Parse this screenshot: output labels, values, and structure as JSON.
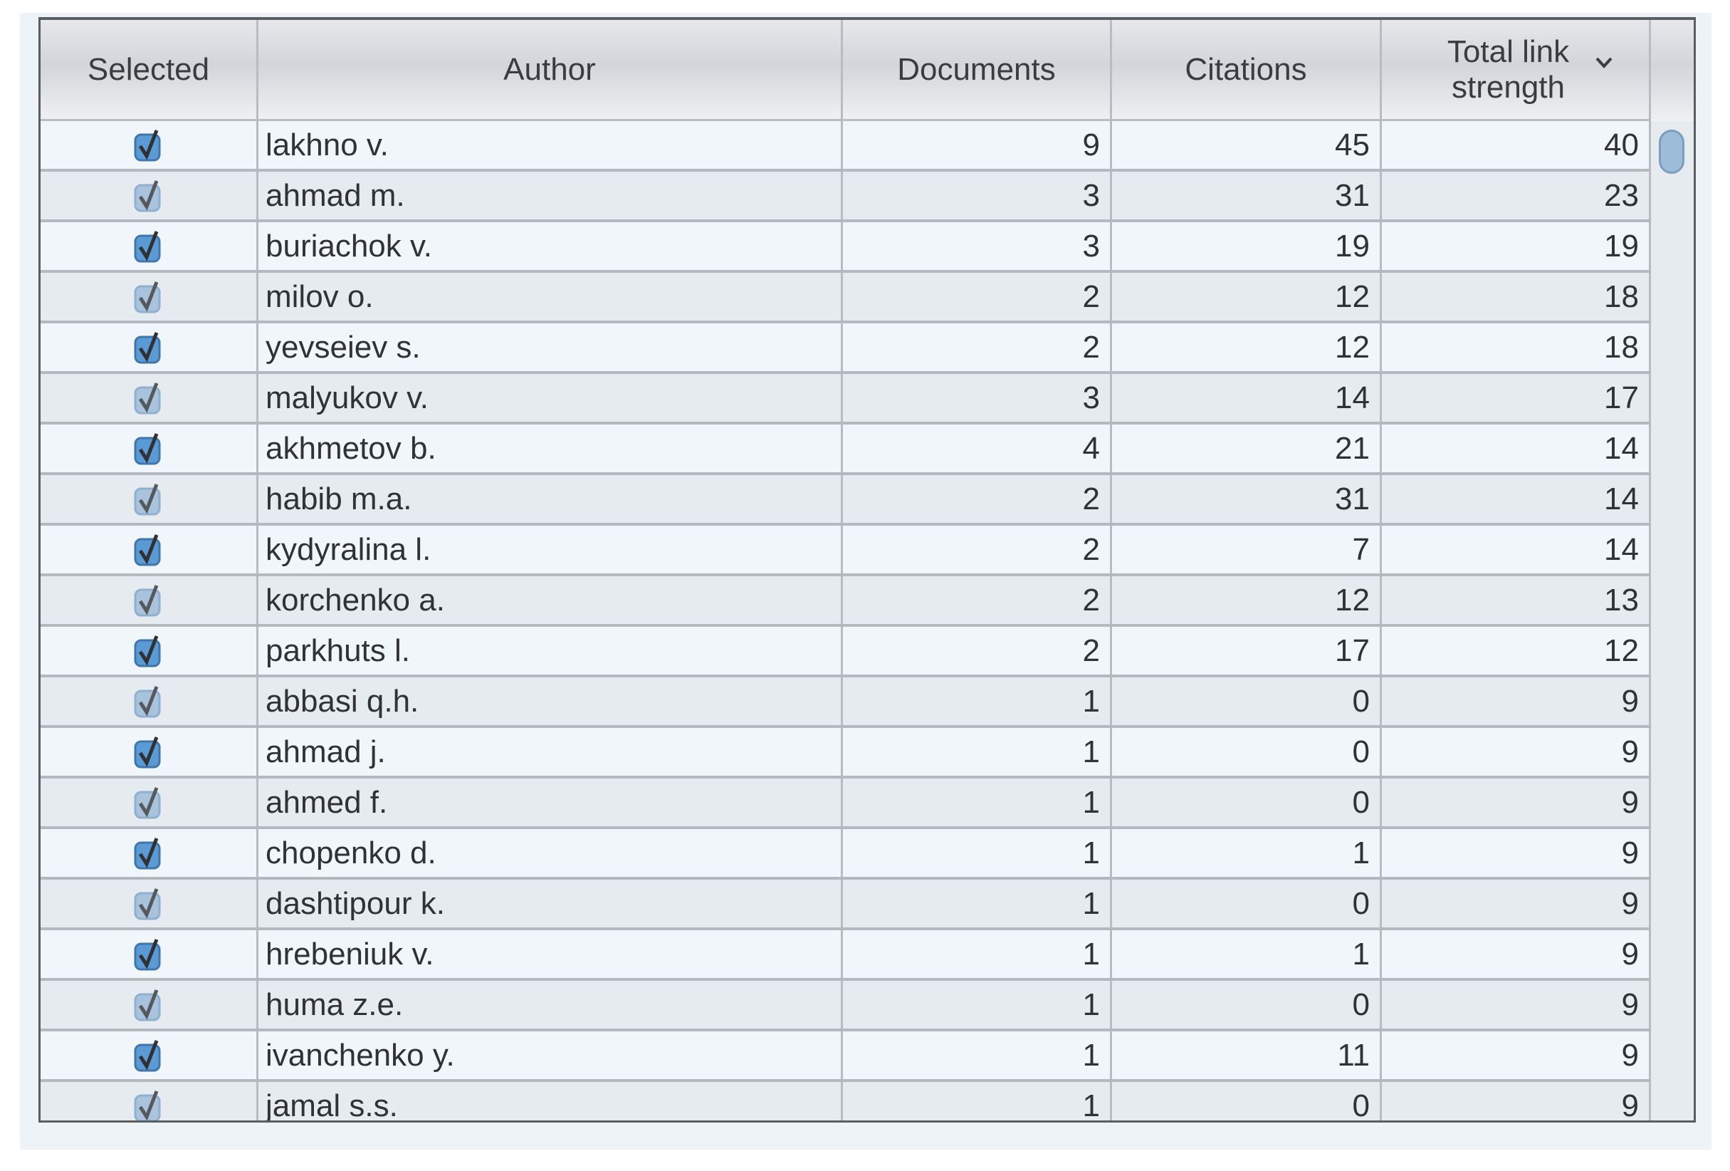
{
  "table": {
    "columns": [
      {
        "key": "selected",
        "label": "Selected"
      },
      {
        "key": "author",
        "label": "Author"
      },
      {
        "key": "documents",
        "label": "Documents"
      },
      {
        "key": "citations",
        "label": "Citations"
      },
      {
        "key": "total_link_strength",
        "label": "Total link strength",
        "sort": "descending"
      }
    ],
    "sort_icon": "chevron-down-icon",
    "checkbox_colors": {
      "active": "#5b9bd5",
      "muted": "#a9c3dc"
    },
    "rows": [
      {
        "selected": true,
        "author": "lakhno v.",
        "documents": "9",
        "citations": "45",
        "total_link_strength": "40"
      },
      {
        "selected": true,
        "author": "ahmad m.",
        "documents": "3",
        "citations": "31",
        "total_link_strength": "23"
      },
      {
        "selected": true,
        "author": "buriachok v.",
        "documents": "3",
        "citations": "19",
        "total_link_strength": "19"
      },
      {
        "selected": true,
        "author": "milov o.",
        "documents": "2",
        "citations": "12",
        "total_link_strength": "18"
      },
      {
        "selected": true,
        "author": "yevseiev s.",
        "documents": "2",
        "citations": "12",
        "total_link_strength": "18"
      },
      {
        "selected": true,
        "author": "malyukov v.",
        "documents": "3",
        "citations": "14",
        "total_link_strength": "17"
      },
      {
        "selected": true,
        "author": "akhmetov b.",
        "documents": "4",
        "citations": "21",
        "total_link_strength": "14"
      },
      {
        "selected": true,
        "author": "habib m.a.",
        "documents": "2",
        "citations": "31",
        "total_link_strength": "14"
      },
      {
        "selected": true,
        "author": "kydyralina l.",
        "documents": "2",
        "citations": "7",
        "total_link_strength": "14"
      },
      {
        "selected": true,
        "author": "korchenko a.",
        "documents": "2",
        "citations": "12",
        "total_link_strength": "13"
      },
      {
        "selected": true,
        "author": "parkhuts l.",
        "documents": "2",
        "citations": "17",
        "total_link_strength": "12"
      },
      {
        "selected": true,
        "author": "abbasi q.h.",
        "documents": "1",
        "citations": "0",
        "total_link_strength": "9"
      },
      {
        "selected": true,
        "author": "ahmad j.",
        "documents": "1",
        "citations": "0",
        "total_link_strength": "9"
      },
      {
        "selected": true,
        "author": "ahmed f.",
        "documents": "1",
        "citations": "0",
        "total_link_strength": "9"
      },
      {
        "selected": true,
        "author": "chopenko d.",
        "documents": "1",
        "citations": "1",
        "total_link_strength": "9"
      },
      {
        "selected": true,
        "author": "dashtipour k.",
        "documents": "1",
        "citations": "0",
        "total_link_strength": "9"
      },
      {
        "selected": true,
        "author": "hrebeniuk v.",
        "documents": "1",
        "citations": "1",
        "total_link_strength": "9"
      },
      {
        "selected": true,
        "author": "huma z.e.",
        "documents": "1",
        "citations": "0",
        "total_link_strength": "9"
      },
      {
        "selected": true,
        "author": "ivanchenko y.",
        "documents": "1",
        "citations": "11",
        "total_link_strength": "9"
      },
      {
        "selected": true,
        "author": "jamal s.s.",
        "documents": "1",
        "citations": "0",
        "total_link_strength": "9"
      }
    ]
  },
  "scrollbar": {
    "position_fraction": 0.0
  }
}
